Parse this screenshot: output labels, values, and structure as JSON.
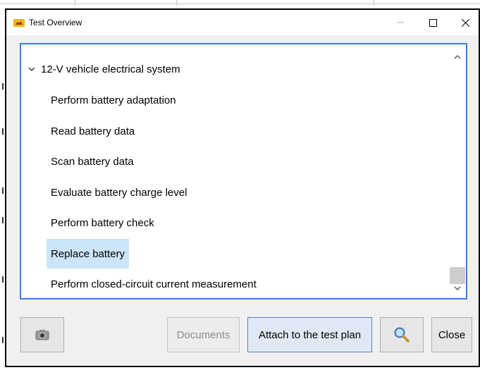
{
  "window": {
    "title": "Test Overview"
  },
  "tree": {
    "group_label": "12-V vehicle electrical system",
    "items": [
      {
        "label": "Perform battery adaptation",
        "selected": false
      },
      {
        "label": "Read battery data",
        "selected": false
      },
      {
        "label": "Scan battery data",
        "selected": false
      },
      {
        "label": "Evaluate battery charge level",
        "selected": false
      },
      {
        "label": "Perform battery check",
        "selected": false
      },
      {
        "label": "Replace battery",
        "selected": true
      },
      {
        "label": "Perform closed-circuit current measurement",
        "selected": false
      }
    ]
  },
  "buttons": {
    "documents": "Documents",
    "attach": "Attach to the test plan",
    "close": "Close"
  },
  "icons": {
    "app": "app-logo-icon",
    "camera": "camera-icon",
    "search": "magnifier-icon"
  },
  "colors": {
    "accent_border": "#3a7fd5",
    "selection": "#cce4f7",
    "app_icon": "#f2b400"
  }
}
